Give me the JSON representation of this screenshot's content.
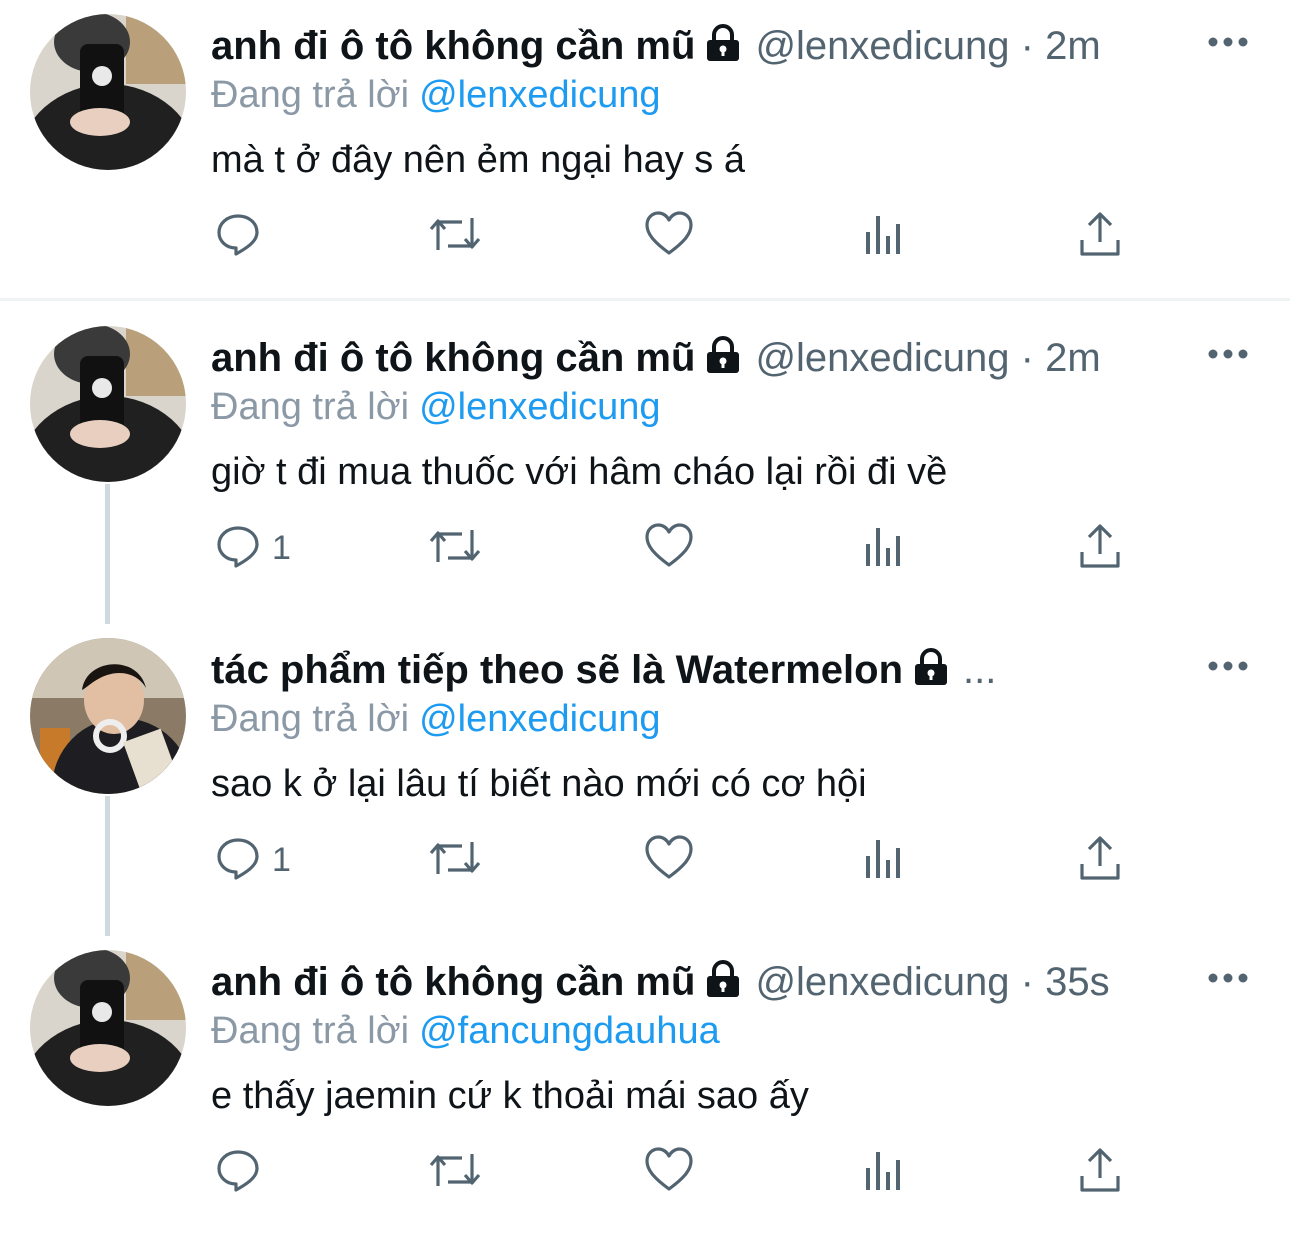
{
  "tweets": [
    {
      "name": "anh đi ô tô không cần mũ",
      "handle": "@lenxedicung · 2m",
      "replying_label": "Đang trả lời",
      "replying_to": "@lenxedicung",
      "text": "mà t ở đây nên ẻm ngại hay s á",
      "reply_count": ""
    },
    {
      "name": "anh đi ô tô không cần mũ",
      "handle": "@lenxedicung · 2m",
      "replying_label": "Đang trả lời",
      "replying_to": "@lenxedicung",
      "text": "giờ t đi mua thuốc với hâm cháo lại rồi đi về",
      "reply_count": "1"
    },
    {
      "name": "tác phẩm tiếp theo sẽ là Watermelon",
      "handle": "...",
      "replying_label": "Đang trả lời",
      "replying_to": "@lenxedicung",
      "text": "sao k ở lại lâu tí biết nào mới có cơ hội",
      "reply_count": "1"
    },
    {
      "name": "anh đi ô tô không cần mũ",
      "handle": "@lenxedicung · 35s",
      "replying_label": "Đang trả lời",
      "replying_to": "@fancungdauhua",
      "text": "e thấy jaemin cứ k thoải mái sao ấy",
      "reply_count": ""
    }
  ],
  "icons": {
    "reply": "reply-icon",
    "retweet": "retweet-icon",
    "like": "heart-icon",
    "views": "views-icon",
    "share": "share-icon",
    "lock": "lock-icon",
    "more": "more-icon"
  },
  "colors": {
    "accent": "#1d9bf0",
    "muted": "#536471",
    "text": "#0f1419",
    "thread": "#cfd9de"
  }
}
